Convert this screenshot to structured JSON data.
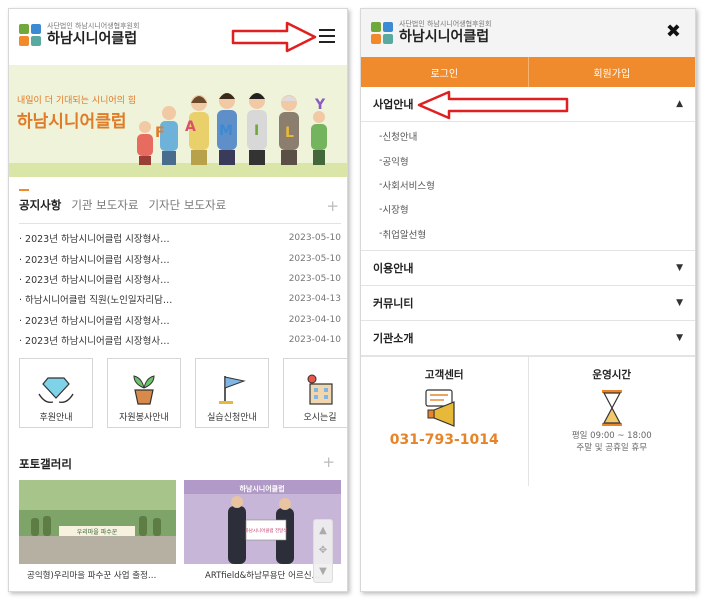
{
  "left": {
    "logo": {
      "sub": "사단법인 하남시니어생협후원회",
      "name": "하남시니어클럽"
    },
    "banner": {
      "tagline": "내일이 더 기대되는 시니어의 힘",
      "title": "하남시니어클럽",
      "letters": [
        "F",
        "A",
        "M",
        "I",
        "L",
        "Y"
      ]
    },
    "notice": {
      "tabs": [
        "공지사항",
        "기관 보도자료",
        "기자단 보도자료"
      ],
      "plus": "+",
      "rows": [
        {
          "title": "2023년 하남시니어클럽 시장형사…",
          "date": "2023-05-10"
        },
        {
          "title": "2023년 하남시니어클럽 시장형사…",
          "date": "2023-05-10"
        },
        {
          "title": "2023년 하남시니어클럽 시장형사…",
          "date": "2023-05-10"
        },
        {
          "title": "하남시니어클럽 직원(노인일자리담…",
          "date": "2023-04-13"
        },
        {
          "title": "2023년 하남시니어클럽 시장형사…",
          "date": "2023-04-10"
        },
        {
          "title": "2023년 하남시니어클럽 시장형사…",
          "date": "2023-04-10"
        }
      ]
    },
    "quick": [
      {
        "label": "후원안내",
        "icon": "diamond-hands-icon"
      },
      {
        "label": "자원봉사안내",
        "icon": "plant-pot-icon"
      },
      {
        "label": "실습신청안내",
        "icon": "flag-icon"
      },
      {
        "label": "오시는길",
        "icon": "building-pin-icon"
      }
    ],
    "gallery": {
      "title": "포토갤러리",
      "plus": "+",
      "photo1_caption": "공익형)우리마을 파수꾼 사업 출정…",
      "photo1_banner": "우리마을 파수꾼",
      "photo2_caption": "ARTfield&하남무용단 어르신…",
      "photo2_banner": "하남시니어클럽",
      "photo2_sign": "하남시니어클럽 전달식"
    }
  },
  "right": {
    "logo": {
      "sub": "사단법인 하남시니어생협후원회",
      "name": "하남시니어클럽"
    },
    "close": "✖",
    "login": "로그인",
    "signup": "회원가입",
    "menus": [
      {
        "label": "사업안내",
        "chev": "▲",
        "subs": [
          "신청안내",
          "공익형",
          "사회서비스형",
          "시장형",
          "취업알선형"
        ]
      },
      {
        "label": "이용안내",
        "chev": "▼"
      },
      {
        "label": "커뮤니티",
        "chev": "▼"
      },
      {
        "label": "기관소개",
        "chev": "▼"
      }
    ],
    "support": {
      "title": "고객센터",
      "phone": "031-793-1014"
    },
    "hours": {
      "title": "운영시간",
      "line1": "평일 09:00 ~ 18:00",
      "line2": "주말 및 공휴일 휴무"
    }
  },
  "colors": {
    "accent": "#ef8b2c",
    "arrow": "#e02020"
  }
}
